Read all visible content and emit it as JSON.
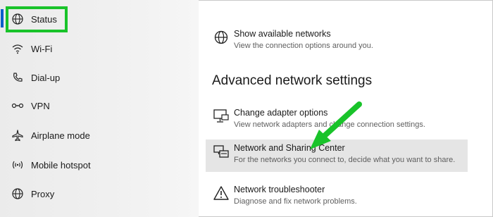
{
  "sidebar": {
    "items": [
      {
        "label": "Status",
        "icon": "globe-icon"
      },
      {
        "label": "Wi-Fi",
        "icon": "wifi-icon"
      },
      {
        "label": "Dial-up",
        "icon": "phone-icon"
      },
      {
        "label": "VPN",
        "icon": "vpn-icon"
      },
      {
        "label": "Airplane mode",
        "icon": "airplane-icon"
      },
      {
        "label": "Mobile hotspot",
        "icon": "hotspot-icon"
      },
      {
        "label": "Proxy",
        "icon": "globe-icon"
      }
    ],
    "active_index": 0,
    "active_color": "#0a5ec9"
  },
  "main": {
    "show_networks": {
      "title": "Show available networks",
      "description": "View the connection options around you."
    },
    "advanced_heading": "Advanced network settings",
    "options": [
      {
        "title": "Change adapter options",
        "description": "View network adapters and change connection settings.",
        "icon": "adapter-icon"
      },
      {
        "title": "Network and Sharing Center",
        "description": "For the networks you connect to, decide what you want to share.",
        "icon": "sharing-center-icon"
      },
      {
        "title": "Network troubleshooter",
        "description": "Diagnose and fix network problems.",
        "icon": "warning-icon"
      }
    ]
  },
  "annotations": {
    "highlight_color": "#19c32a",
    "arrow_color": "#19c32a"
  }
}
